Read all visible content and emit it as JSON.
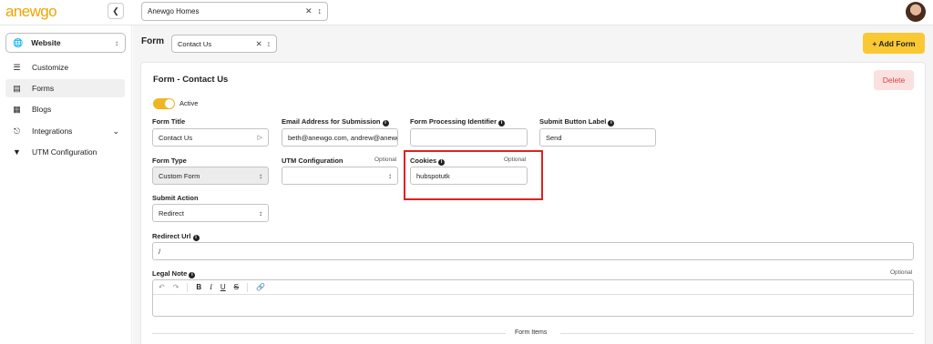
{
  "app": {
    "logo_text": "anewgo"
  },
  "topbar": {
    "home_select": "Anewgo Homes"
  },
  "sidebar": {
    "site_select": "Website",
    "items": [
      {
        "label": "Customize",
        "icon": "sliders-icon"
      },
      {
        "label": "Forms",
        "icon": "forms-icon",
        "active": true
      },
      {
        "label": "Blogs",
        "icon": "newspaper-icon"
      },
      {
        "label": "Integrations",
        "icon": "plug-icon"
      },
      {
        "label": "UTM Configuration",
        "icon": "filter-icon"
      }
    ]
  },
  "header": {
    "title": "Form",
    "form_select": "Contact Us",
    "add_button": "+ Add Form"
  },
  "card": {
    "title": "Form - Contact Us",
    "delete_button": "Delete",
    "active_label": "Active",
    "form_title_label": "Form Title",
    "form_title_value": "Contact Us",
    "email_label": "Email Address for Submission",
    "email_value": "beth@anewgo.com, andrew@anewgo",
    "processing_label": "Form Processing Identifier",
    "processing_value": "",
    "submit_label_label": "Submit Button Label",
    "submit_label_value": "Send",
    "form_type_label": "Form Type",
    "form_type_value": "Custom Form",
    "utm_label": "UTM Configuration",
    "utm_value": "",
    "cookies_label": "Cookies",
    "cookies_value": "hubspotutk",
    "optional": "Optional",
    "submit_action_label": "Submit Action",
    "submit_action_value": "Redirect",
    "redirect_label": "Redirect Url",
    "redirect_value": "/",
    "legal_label": "Legal Note",
    "form_items": "Form Items"
  },
  "colors": {
    "accent": "#f9c833",
    "toggle": "#f0b622",
    "delete_bg": "#fbe0e0",
    "delete_text": "#d64545",
    "highlight": "#e02020"
  }
}
